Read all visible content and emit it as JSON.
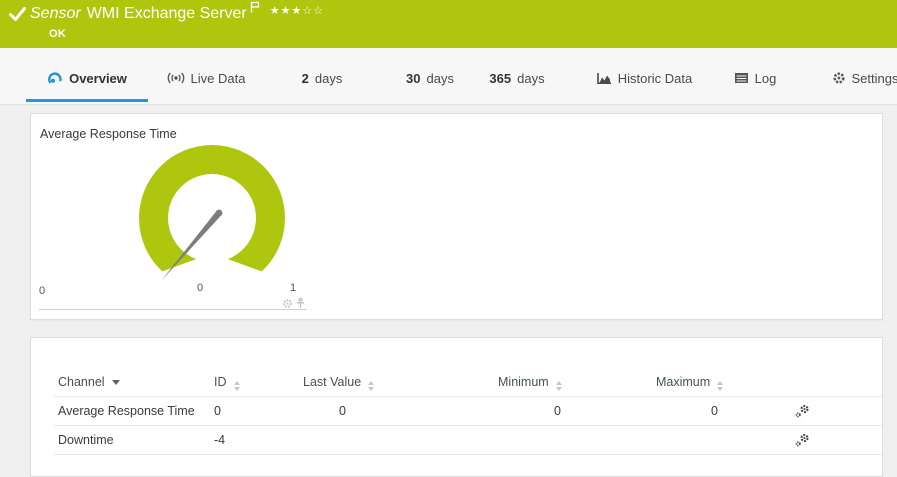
{
  "header": {
    "kind_label": "Sensor",
    "title": "WMI Exchange Server",
    "status": "OK",
    "stars_filled": "★★★",
    "stars_empty": "☆☆"
  },
  "tabs": [
    {
      "label": "Overview",
      "active": true
    },
    {
      "label": "Live Data"
    },
    {
      "num": "2",
      "label": "days"
    },
    {
      "num": "30",
      "label": "days"
    },
    {
      "num": "365",
      "label": "days"
    },
    {
      "label": "Historic Data"
    },
    {
      "label": "Log"
    },
    {
      "label": "Settings"
    }
  ],
  "gauge": {
    "title": "Average Response Time",
    "scale_min": "0",
    "scale_max": "1",
    "axis_zero": "0",
    "value": 0
  },
  "table": {
    "columns": {
      "channel": "Channel",
      "id": "ID",
      "last_value": "Last Value",
      "minimum": "Minimum",
      "maximum": "Maximum"
    },
    "sorted_by": "Channel",
    "rows": [
      {
        "channel": "Average Response Time",
        "id": "0",
        "last_value": "0",
        "min": "0",
        "max": "0"
      },
      {
        "channel": "Downtime",
        "id": "-4",
        "last_value": "",
        "min": "",
        "max": ""
      }
    ]
  },
  "colors": {
    "brand_green": "#aec70e",
    "accent_blue": "#2299d4",
    "needle_gray": "#7d7d7d"
  }
}
